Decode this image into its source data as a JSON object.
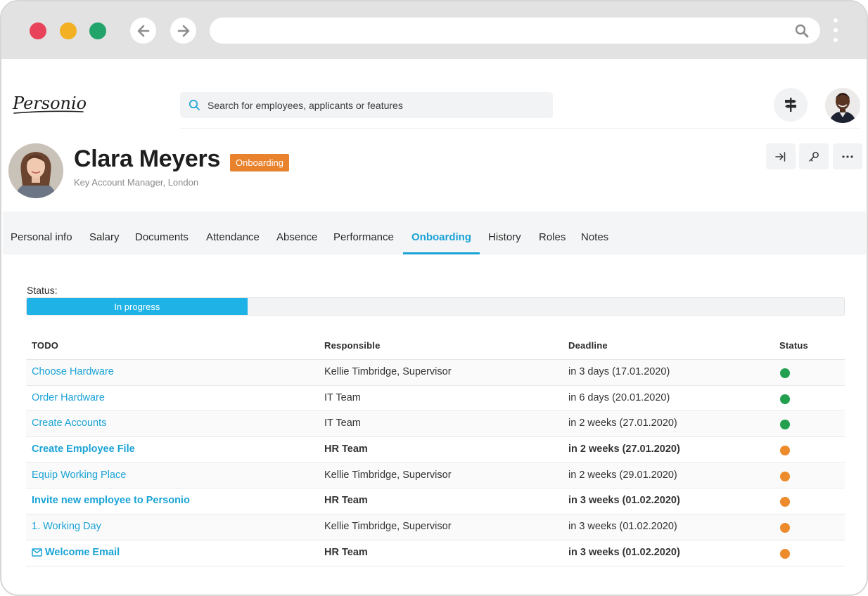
{
  "browser": {
    "search_icon": "search-icon",
    "menu_icon": "kebab-menu-icon"
  },
  "app": {
    "logo_text": "Personio",
    "search_placeholder": "Search for employees, applicants or features"
  },
  "employee": {
    "name": "Clara Meyers",
    "badge": "Onboarding",
    "subtitle": "Key Account Manager, London"
  },
  "tabs": [
    {
      "label": "Personal info",
      "active": false
    },
    {
      "label": "Salary",
      "active": false
    },
    {
      "label": "Documents",
      "active": false
    },
    {
      "label": "Attendance",
      "active": false
    },
    {
      "label": "Absence",
      "active": false
    },
    {
      "label": "Performance",
      "active": false
    },
    {
      "label": "Onboarding",
      "active": true
    },
    {
      "label": "History",
      "active": false
    },
    {
      "label": "Roles",
      "active": false
    },
    {
      "label": "Notes",
      "active": false
    }
  ],
  "status": {
    "label": "Status:",
    "progress_label": "In progress",
    "progress_fraction": 0.27
  },
  "table": {
    "headers": {
      "todo": "TODO",
      "responsible": "Responsible",
      "deadline": "Deadline",
      "status": "Status"
    },
    "rows": [
      {
        "todo": "Choose Hardware",
        "responsible": "Kellie Timbridge, Supervisor",
        "deadline": "in 3 days (17.01.2020)",
        "status": "done",
        "bold": false
      },
      {
        "todo": "Order Hardware",
        "responsible": "IT Team",
        "deadline": "in 6 days (20.01.2020)",
        "status": "done",
        "bold": false
      },
      {
        "todo": "Create Accounts",
        "responsible": "IT Team",
        "deadline": "in 2 weeks (27.01.2020)",
        "status": "done",
        "bold": false
      },
      {
        "todo": "Create Employee File",
        "responsible": "HR Team",
        "deadline": "in 2 weeks (27.01.2020)",
        "status": "open",
        "bold": true
      },
      {
        "todo": "Equip Working Place",
        "responsible": "Kellie Timbridge, Supervisor",
        "deadline": "in 2 weeks (29.01.2020)",
        "status": "open",
        "bold": false
      },
      {
        "todo": "Invite new employee to Personio",
        "responsible": "HR Team",
        "deadline": "in 3 weeks (01.02.2020)",
        "status": "open",
        "bold": true
      },
      {
        "todo": "1. Working Day",
        "responsible": "Kellie Timbridge, Supervisor",
        "deadline": "in 3 weeks (01.02.2020)",
        "status": "open",
        "bold": false
      },
      {
        "todo": "Welcome Email",
        "responsible": "HR Team",
        "deadline": "in 3 weeks (01.02.2020)",
        "status": "open",
        "bold": true,
        "icon": "mail-icon"
      }
    ]
  },
  "colors": {
    "accent": "#1aa3d6",
    "badge": "#e9822c",
    "status_done": "#22a04f",
    "status_open": "#ec8a2c"
  }
}
